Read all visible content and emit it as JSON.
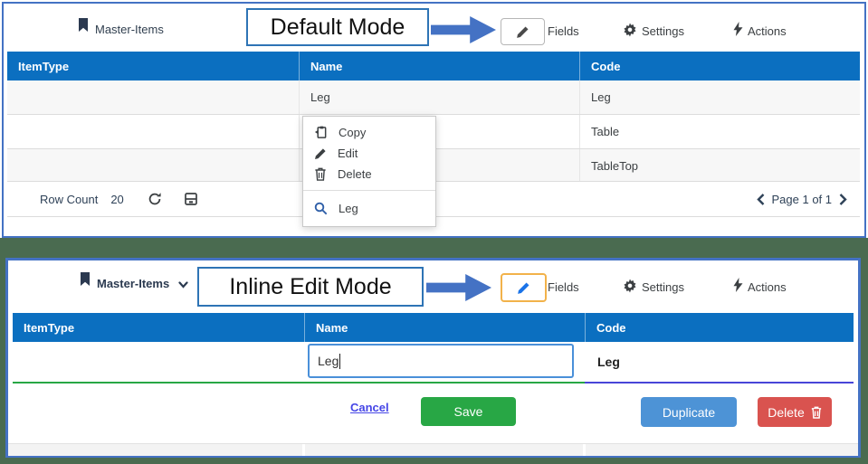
{
  "top_panel": {
    "title": "Master-Items",
    "annotation": "Default Mode",
    "toolbar": {
      "fields": "Fields",
      "settings": "Settings",
      "actions": "Actions"
    },
    "table": {
      "headers": [
        "ItemType",
        "Name",
        "Code"
      ],
      "rows": [
        {
          "item_type": "",
          "name": "Leg",
          "code": "Leg"
        },
        {
          "item_type": "",
          "name": "",
          "code": "Table"
        },
        {
          "item_type": "",
          "name": "",
          "code": "TableTop"
        }
      ]
    },
    "context_menu": {
      "copy": "Copy",
      "edit": "Edit",
      "delete": "Delete",
      "search": "Leg"
    },
    "footer": {
      "row_count_label": "Row Count",
      "row_count_value": "20",
      "pagination": "Page 1 of 1"
    }
  },
  "bottom_panel": {
    "title": "Master-Items",
    "annotation": "Inline Edit Mode",
    "toolbar": {
      "fields": "Fields",
      "settings": "Settings",
      "actions": "Actions"
    },
    "table": {
      "headers": [
        "ItemType",
        "Name",
        "Code"
      ],
      "edit_row": {
        "name_value": "Leg",
        "code_value": "Leg"
      }
    },
    "actions": {
      "cancel": "Cancel",
      "save": "Save",
      "duplicate": "Duplicate",
      "delete": "Delete"
    }
  },
  "colors": {
    "header_blue": "#0b6fc0",
    "panel_border_blue": "#4472c4",
    "background_green": "#4a6b50",
    "save_green": "#28a745",
    "duplicate_blue": "#4d93d6",
    "delete_red": "#d9534f",
    "edit_highlight_orange": "#f2b24a",
    "edit_underline_green": "#28a745",
    "code_underline_indigo": "#4845d8"
  }
}
